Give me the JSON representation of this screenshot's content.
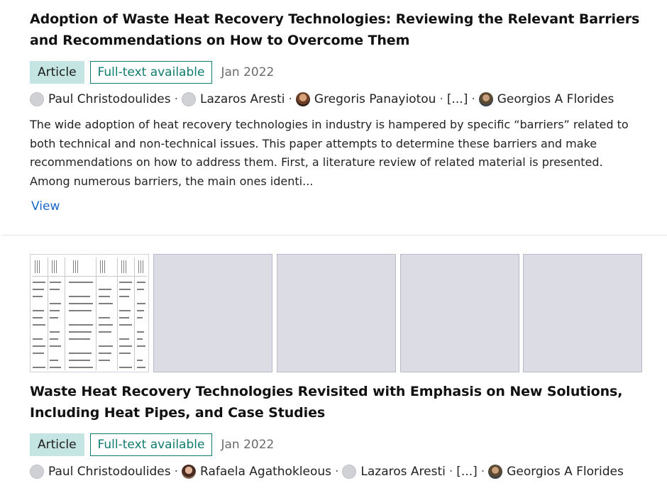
{
  "results": [
    {
      "title": "Adoption of Waste Heat Recovery Technologies: Reviewing the Relevant Barriers and Recommendations on How to Overcome Them",
      "badge_type": "Article",
      "badge_fulltext": "Full-text available",
      "date": "Jan 2022",
      "authors": [
        {
          "name": "Paul Christodoulides",
          "avatar": "default"
        },
        {
          "name": "Lazaros Aresti",
          "avatar": "default"
        },
        {
          "name": "Gregoris Panayiotou",
          "avatar": "photo"
        },
        {
          "name": "[...]",
          "avatar": "none"
        },
        {
          "name": "Georgios A Florides",
          "avatar": "photo"
        }
      ],
      "abstract": "The wide adoption of heat recovery technologies in industry is hampered by specific “barriers” related to both technical and non-technical issues. This paper attempts to determine these barriers and make recommendations on how to address them. First, a literature review of related material is presented. Among numerous barriers, the main ones identi...",
      "view_label": "View"
    },
    {
      "title": "Waste Heat Recovery Technologies Revisited with Emphasis on New Solutions, Including Heat Pipes, and Case Studies",
      "badge_type": "Article",
      "badge_fulltext": "Full-text available",
      "date": "Jan 2022",
      "authors": [
        {
          "name": "Paul Christodoulides",
          "avatar": "default"
        },
        {
          "name": "Rafaela Agathokleous",
          "avatar": "photo"
        },
        {
          "name": "Lazaros Aresti",
          "avatar": "default"
        },
        {
          "name": "[...]",
          "avatar": "none"
        },
        {
          "name": "Georgios A Florides",
          "avatar": "photo"
        }
      ],
      "thumbnails": [
        "table-preview",
        "placeholder",
        "placeholder",
        "placeholder",
        "placeholder"
      ]
    }
  ],
  "colors": {
    "article_badge_bg": "#c4e5e1",
    "fulltext_border": "#0e7c6f",
    "link": "#1a66c9",
    "thumb_placeholder": "#dcdce5"
  }
}
